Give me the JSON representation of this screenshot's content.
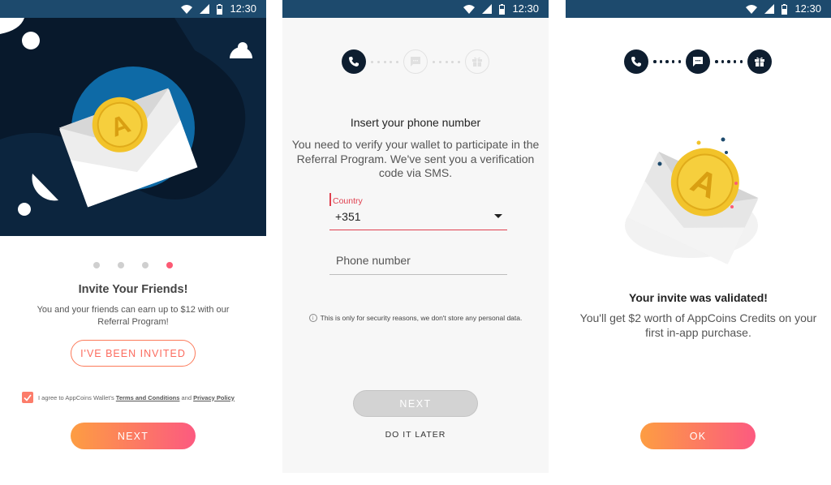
{
  "status_bar": {
    "time": "12:30"
  },
  "screen1": {
    "carousel": {
      "total": 4,
      "active": 4
    },
    "title": "Invite Your Friends!",
    "body": "You and your friends can earn up to $12 with our Referral Program!",
    "invited_button": "I'VE BEEN INVITED",
    "terms": {
      "checked": true,
      "prefix": "I agree to AppCoins Wallet's ",
      "terms_link": "Terms and Conditions",
      "and": " and ",
      "privacy_link": "Privacy Policy"
    },
    "next_button": "NEXT"
  },
  "screen2": {
    "stepper": [
      "phone-icon",
      "chat-icon",
      "gift-icon"
    ],
    "active_step": 1,
    "title": "Insert your phone number",
    "body": "You need to verify your wallet to participate in the Referral Program. We've sent you a verification code via SMS.",
    "country": {
      "label": "Country",
      "value": "+351"
    },
    "phone": {
      "placeholder": "Phone number",
      "value": ""
    },
    "note": "This is only for security reasons, we don't store any personal data.",
    "next_button": "NEXT",
    "later_button": "DO IT LATER"
  },
  "screen3": {
    "stepper": [
      "phone-icon",
      "chat-icon",
      "gift-icon"
    ],
    "active_step": 3,
    "title": "Your invite was validated!",
    "body": "You'll get $2 worth of AppCoins Credits on your first in-app purchase.",
    "ok_button": "OK"
  },
  "colors": {
    "status_bar": "#1d4a6d",
    "accent_start": "#fd9d42",
    "accent_end": "#fc5a80",
    "error_red": "#e0404f",
    "navy": "#0e1e30",
    "coin_gold": "#f2c32a"
  }
}
